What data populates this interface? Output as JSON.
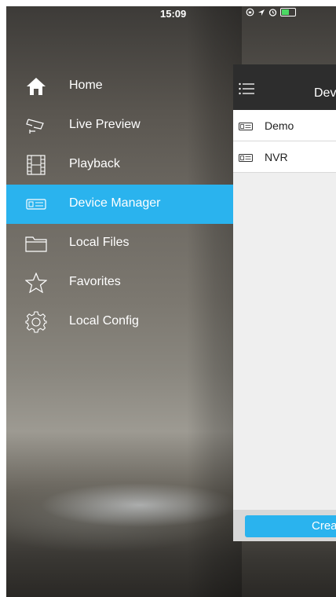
{
  "status": {
    "time": "15:09",
    "icons": [
      "lock-rotation-icon",
      "location-icon",
      "alarm-icon",
      "battery-icon"
    ]
  },
  "menu": {
    "items": [
      {
        "label": "Home",
        "icon": "home-icon",
        "active": false
      },
      {
        "label": "Live Preview",
        "icon": "camera-icon",
        "active": false
      },
      {
        "label": "Playback",
        "icon": "film-icon",
        "active": false
      },
      {
        "label": "Device Manager",
        "icon": "device-icon",
        "active": true
      },
      {
        "label": "Local Files",
        "icon": "folder-icon",
        "active": false
      },
      {
        "label": "Favorites",
        "icon": "star-icon",
        "active": false
      },
      {
        "label": "Local Config",
        "icon": "gear-icon",
        "active": false
      }
    ]
  },
  "panel": {
    "title": "Dev",
    "devices": [
      {
        "label": "Demo",
        "icon": "device-icon"
      },
      {
        "label": "NVR",
        "icon": "device-icon"
      }
    ],
    "create_label": "Crea"
  },
  "colors": {
    "accent": "#2ab3ee",
    "header": "#2d2d2d",
    "battery": "#4cd964"
  }
}
